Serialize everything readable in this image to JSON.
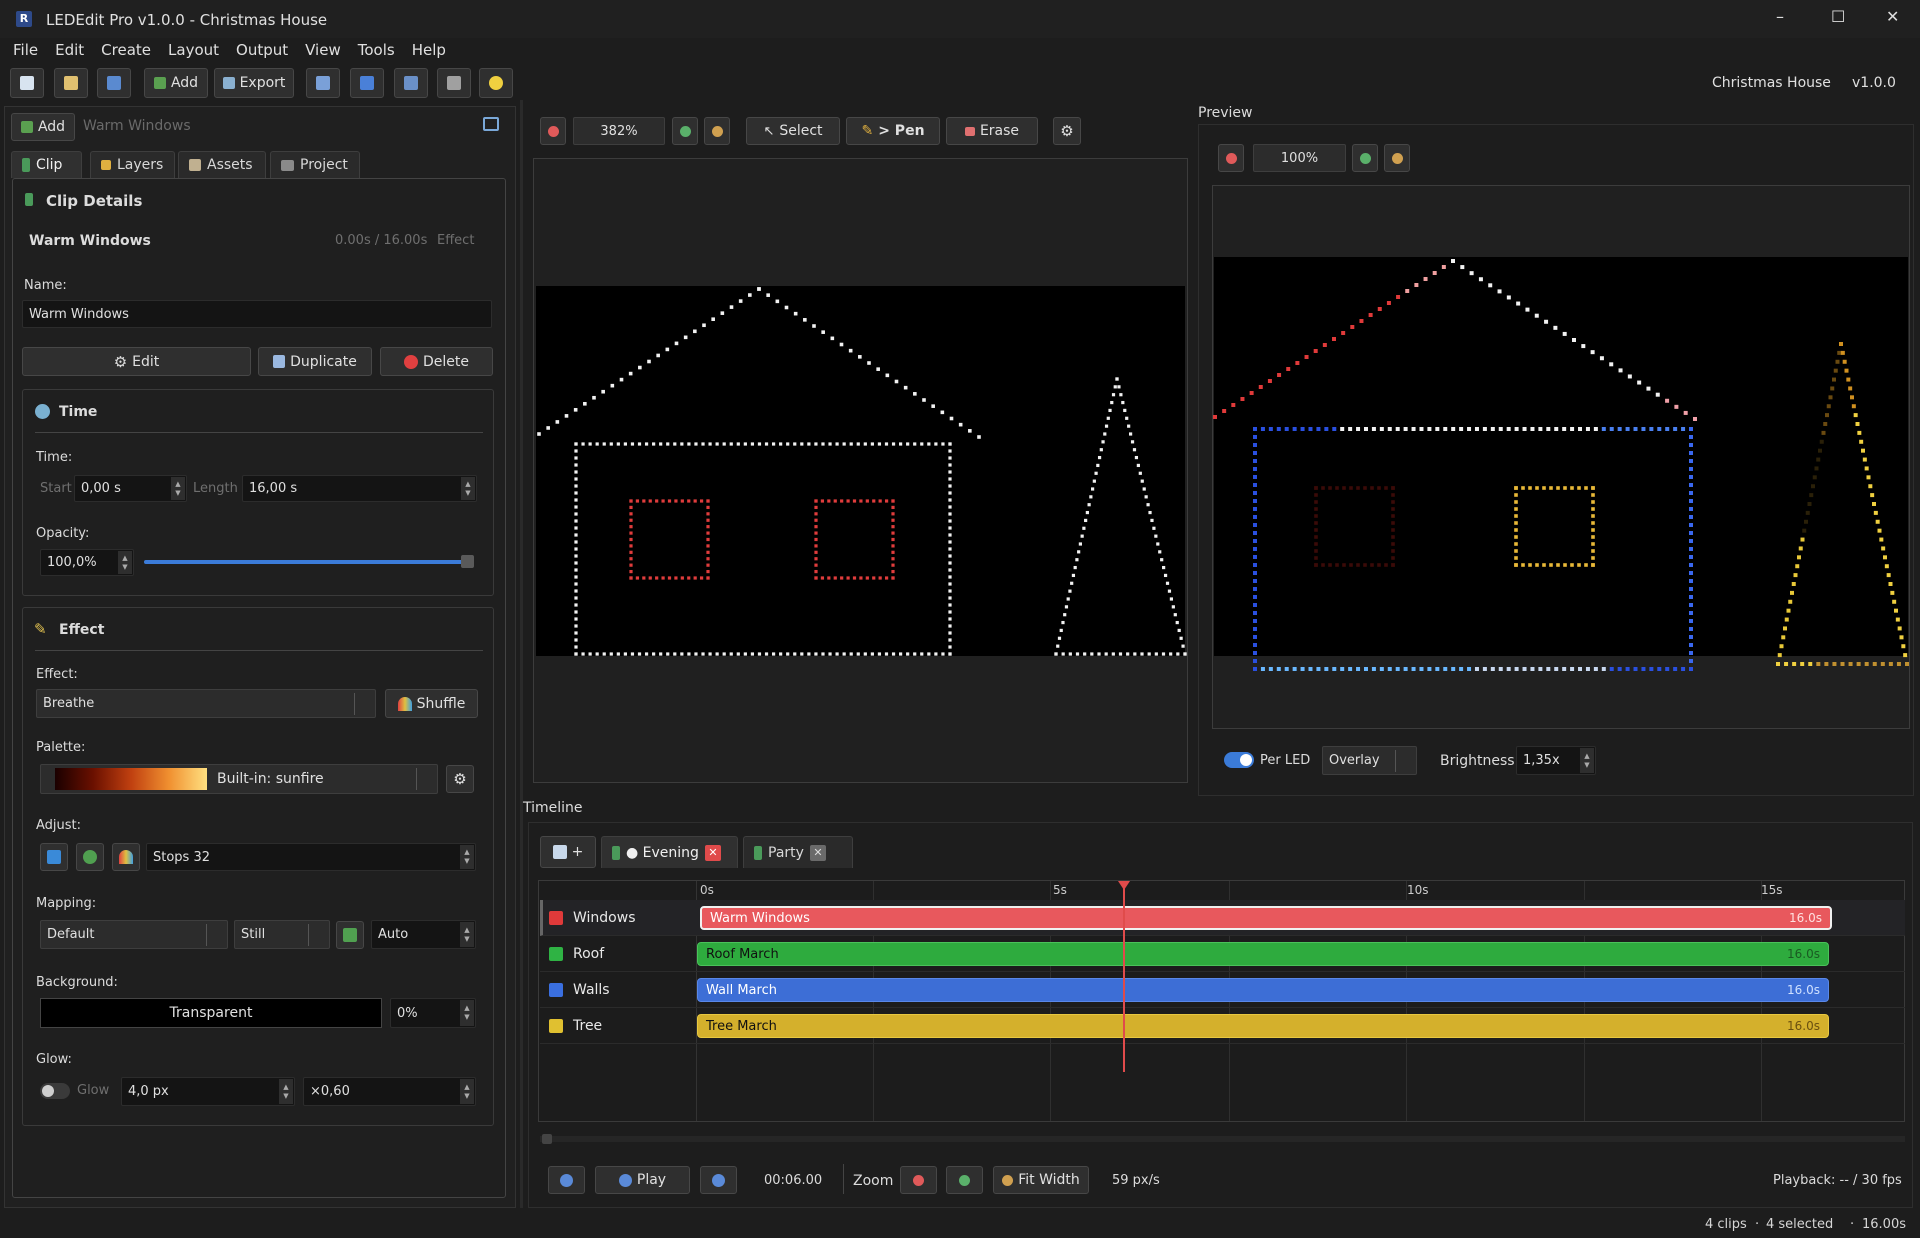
{
  "window": {
    "title": "LEDEdit Pro v1.0.0 - Christmas House",
    "app_icon": "app-logo-icon",
    "controls": {
      "minimize": "–",
      "maximize": "☐",
      "close": "✕"
    }
  },
  "menu": [
    "File",
    "Edit",
    "Create",
    "Layout",
    "Output",
    "View",
    "Tools",
    "Help"
  ],
  "toolbar": {
    "add_label": "Add",
    "export_label": "Export",
    "project_name": "Christmas House",
    "version": "v1.0.0"
  },
  "left": {
    "add_label": "Add",
    "clip_name_header": "Warm Windows",
    "tabs": [
      "Clip",
      "Layers",
      "Assets",
      "Project"
    ],
    "clip_details": {
      "heading": "Clip Details",
      "clip_name": "Warm Windows",
      "time_info": "0.00s / 16.00s",
      "type": "Effect",
      "name_label": "Name:",
      "name_value": "Warm Windows",
      "edit_label": "Edit",
      "duplicate_label": "Duplicate",
      "delete_label": "Delete"
    },
    "time": {
      "heading": "Time",
      "time_label": "Time:",
      "start_label": "Start",
      "start_value": "0,00 s",
      "length_label": "Length",
      "length_value": "16,00 s",
      "opacity_label": "Opacity:",
      "opacity_value": "100,0%",
      "opacity_fraction": 1.0
    },
    "effect": {
      "heading": "Effect",
      "effect_label": "Effect:",
      "effect_value": "Breathe",
      "shuffle_label": "Shuffle",
      "palette_label": "Palette:",
      "palette_value": "Built-in: sunfire",
      "adjust_label": "Adjust:",
      "stops_value": "Stops 32",
      "mapping_label": "Mapping:",
      "mapping_value": "Default",
      "still_value": "Still",
      "auto_value": "Auto",
      "background_label": "Background:",
      "background_value": "Transparent",
      "background_percent": "0%",
      "glow_label": "Glow:",
      "glow_toggle_label": "Glow",
      "glow_value": "4,0 px",
      "glow_mult": "×0,60"
    }
  },
  "editor": {
    "zoom": "382%",
    "select_label": "Select",
    "pen_label": "> Pen",
    "erase_label": "Erase"
  },
  "preview": {
    "title": "Preview",
    "zoom": "100%",
    "per_led_label": "Per LED",
    "blend_value": "Overlay",
    "brightness_label": "Brightness",
    "brightness_value": "1,35x"
  },
  "timeline": {
    "title": "Timeline",
    "tabs": [
      {
        "label": "● Evening"
      },
      {
        "label": "Party"
      }
    ],
    "ruler": [
      "0s",
      "5s",
      "10s",
      "15s"
    ],
    "tracks": [
      {
        "name": "Windows",
        "color": "#e03a3a",
        "clip": "Warm Windows",
        "duration": "16.0s",
        "clip_color": "#e8585d"
      },
      {
        "name": "Roof",
        "color": "#2fb344",
        "clip": "Roof March",
        "duration": "16.0s",
        "clip_color": "#2eab3e"
      },
      {
        "name": "Walls",
        "color": "#3a6fe0",
        "clip": "Wall March",
        "duration": "16.0s",
        "clip_color": "#3d6ed6"
      },
      {
        "name": "Tree",
        "color": "#e0c030",
        "clip": "Tree March",
        "duration": "16.0s",
        "clip_color": "#d4b02c"
      }
    ],
    "play_label": "Play",
    "time": "00:06.00",
    "zoom_label": "Zoom",
    "fit_label": "Fit Width",
    "px_per_s": "59 px/s",
    "playback": "Playback: -- / 30 fps"
  },
  "status": {
    "clips": "4 clips",
    "selected": "4 selected",
    "duration": "16.00s"
  }
}
